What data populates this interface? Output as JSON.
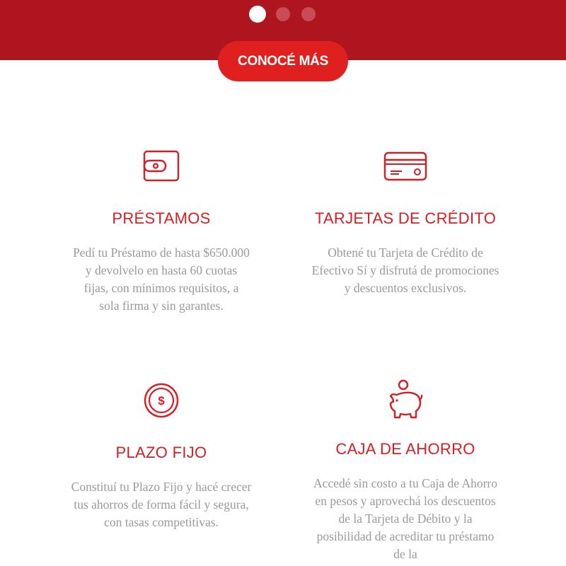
{
  "carousel": {
    "dot_count": 3,
    "active_index": 0
  },
  "hero": {
    "cta_label": "CONOCÉ MÁS"
  },
  "colors": {
    "brand_red": "#af151f",
    "accent_red": "#d31f24",
    "button_red": "#e0201e",
    "text_gray": "#9a9a9a"
  },
  "products": [
    {
      "icon": "wallet-icon",
      "title": "PRÉSTAMOS",
      "description": "Pedí tu Préstamo de hasta $650.000 y devolvelo en hasta 60 cuotas fijas, con mínimos requisitos, a sola firma y sin garantes."
    },
    {
      "icon": "credit-card-icon",
      "title": "TARJETAS DE CRÉDITO",
      "description": "Obtené tu Tarjeta de Crédito de Efectivo Sí y disfrutá de promociones y descuentos exclusivos."
    },
    {
      "icon": "dollar-coin-icon",
      "title": "PLAZO FIJO",
      "description": "Constituí tu Plazo Fijo y hacé crecer tus ahorros de forma fácil y segura, con tasas competitivas."
    },
    {
      "icon": "piggy-bank-icon",
      "title": "CAJA DE AHORRO",
      "description": "Accedé sin costo a tu Caja de Ahorro en pesos y aprovechá los descuentos de la Tarjeta de Débito y la posibilidad de acreditar tu préstamo de la"
    }
  ]
}
